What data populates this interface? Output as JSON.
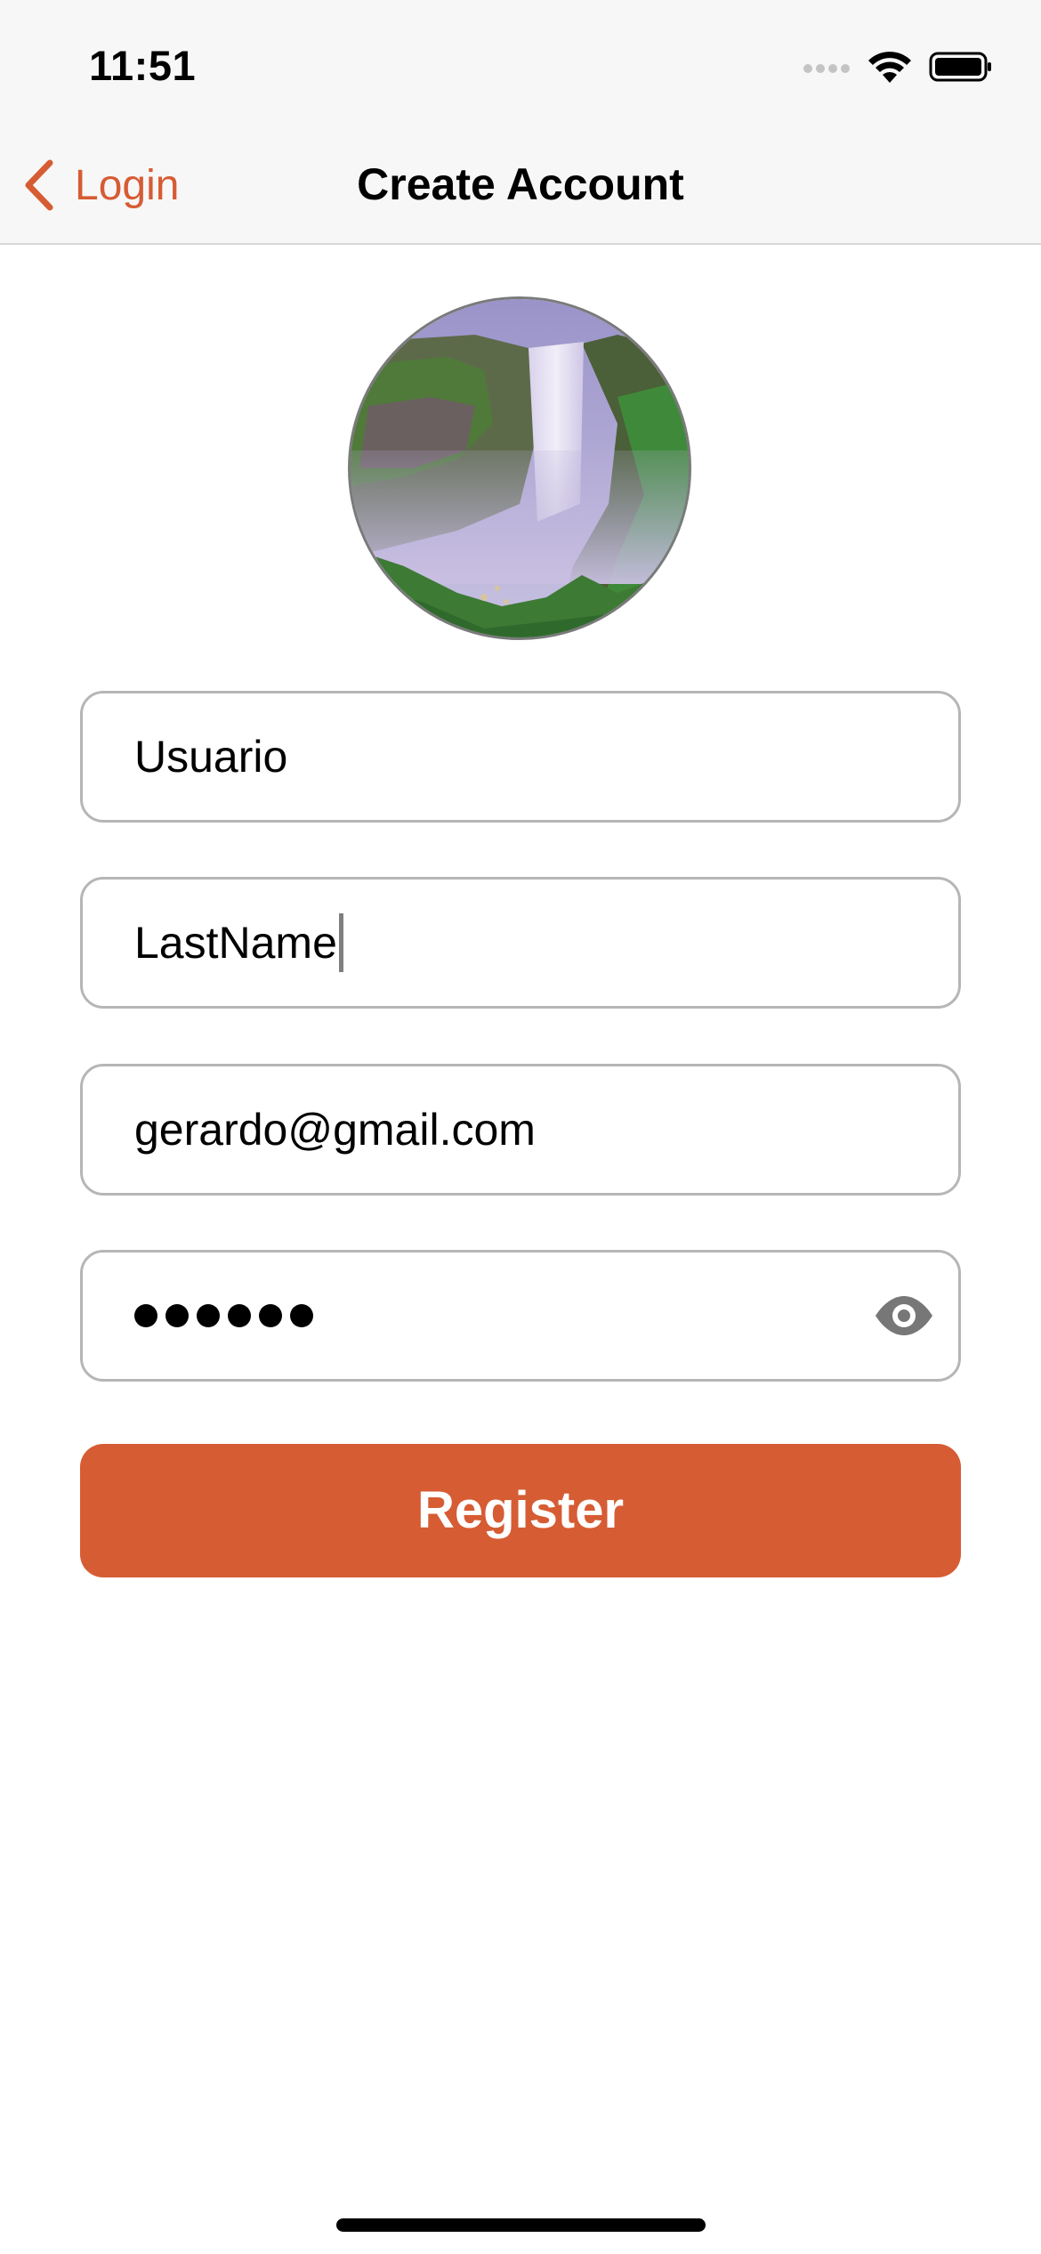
{
  "status_bar": {
    "time": "11:51",
    "icons": [
      "signal-icon",
      "wifi-icon",
      "battery-icon"
    ]
  },
  "nav": {
    "back_label": "Login",
    "back_icon": "chevron-left-icon",
    "title": "Create Account"
  },
  "avatar": {
    "icon": "profile-photo-waterfall"
  },
  "form": {
    "first_name_value": "Usuario",
    "last_name_value": "LastName",
    "email_value": "gerardo@gmail.com",
    "password_masked_length": 6,
    "password_toggle_icon": "eye-icon",
    "register_label": "Register"
  },
  "colors": {
    "accent": "#d65c33",
    "field_border": "#b6b6b6",
    "bar_background": "#f7f7f7"
  }
}
